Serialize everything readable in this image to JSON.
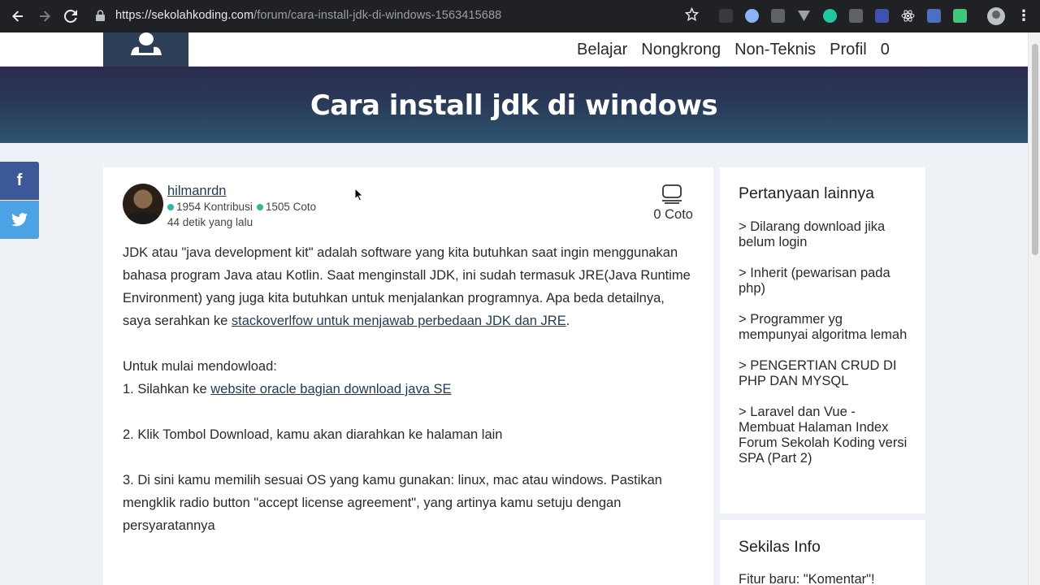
{
  "browser": {
    "url_host": "https://sekolahkoding.com",
    "url_path": "/forum/cara-install-jdk-di-windows-1563415688",
    "back_icon": "arrow-left",
    "forward_icon": "arrow-right",
    "reload_icon": "reload",
    "bookmark_icon": "star",
    "menu_icon": "three-dots"
  },
  "site_nav": {
    "links": [
      "Belajar",
      "Nongkrong",
      "Non-Teknis",
      "Profil",
      "0"
    ]
  },
  "hero": {
    "title": "Cara install jdk di windows"
  },
  "share": {
    "facebook": "f",
    "twitter": "twitter-bird"
  },
  "post": {
    "author": "hilmanrdn ",
    "contributions": "1954 Kontribusi",
    "coto": "1505 Coto",
    "time": "44 detik yang lalu",
    "coto_count": "0 Coto",
    "p1_text": "JDK atau \"java development kit\" adalah software yang kita butuhkan saat ingin menggunakan bahasa program Java atau Kotlin. Saat menginstall JDK, ini sudah termasuk JRE(Java Runtime Environment) yang juga kita butuhkan untuk menjalankan programnya. Apa beda detailnya, saya serahkan ke ",
    "p1_link": "stackoverlfow untuk menjawab perbedaan JDK dan JRE",
    "p1_end": ".",
    "p2_line1": "Untuk mulai mendowload:",
    "p2_step1_prefix": "1. Silahkan ke ",
    "p2_step1_link": "website oracle bagian download java SE",
    "p3": "2. Klik Tombol Download, kamu akan diarahkan ke halaman lain",
    "p4": "3. Di sini kamu memilih sesuai OS yang kamu gunakan: linux, mac atau windows. Pastikan mengklik radio button \"accept license agreement\", yang artinya kamu setuju dengan persyaratannya"
  },
  "sidebar": {
    "title": "Pertanyaan lainnya",
    "items": [
      "> Dilarang download jika belum login",
      "> Inherit (pewarisan pada php)",
      "> Programmer yg mempunyai algoritma lemah",
      "> PENGERTIAN CRUD DI PHP DAN MYSQL",
      "> Laravel dan Vue - Membuat Halaman Index Forum Sekolah Koding versi SPA (Part 2)"
    ],
    "info_title": "Sekilas Info",
    "info_text": "Fitur baru: \"Komentar\"!"
  },
  "colors": {
    "hero_gradient_top": "#2b2b4c",
    "hero_gradient_bottom": "#2d5570",
    "facebook": "#3b5998",
    "twitter": "#4ba3e6",
    "stat_dot": "#31b7a0",
    "link": "#1e3a5a"
  }
}
